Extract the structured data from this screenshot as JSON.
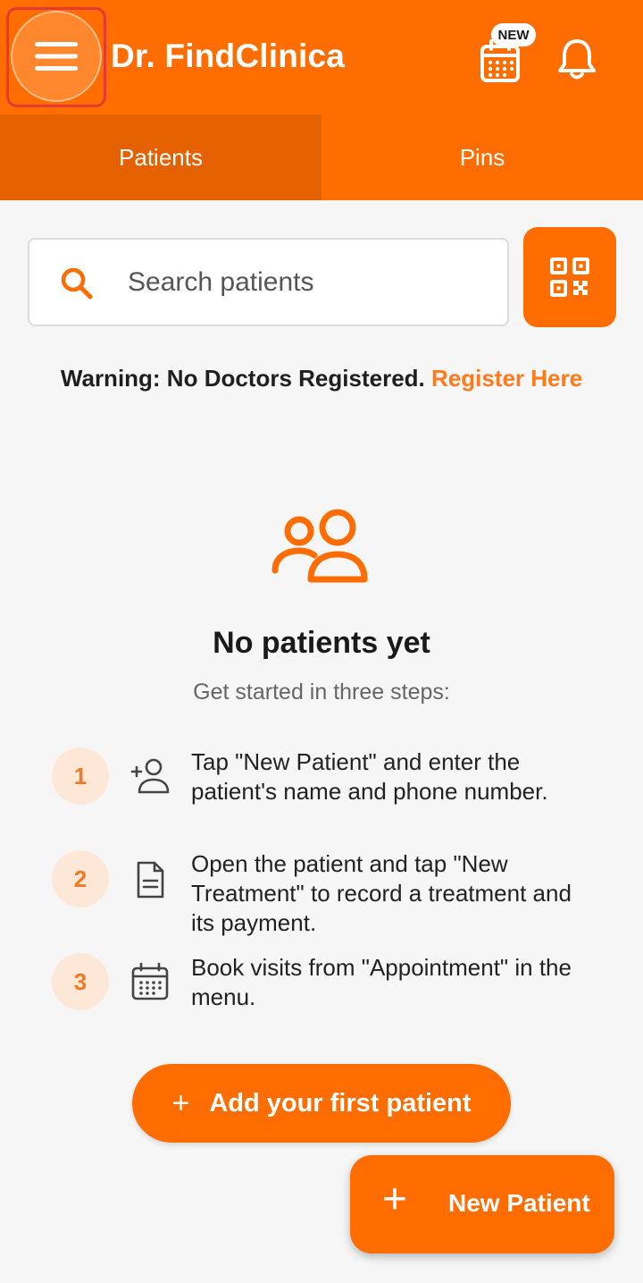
{
  "appbar": {
    "title": "Dr. FindClinica",
    "menu_icon": "hamburger-menu-icon",
    "calendar_icon": "calendar-icon",
    "new_badge": "NEW",
    "bell_icon": "bell-icon",
    "color": "#ff6d00"
  },
  "tabs": [
    {
      "label": "Patients",
      "active": true
    },
    {
      "label": "Pins",
      "active": false
    }
  ],
  "search": {
    "placeholder": "Search patients",
    "value": "",
    "icon": "search-icon",
    "qr_icon": "qr-code-icon"
  },
  "warning": {
    "text": "Warning: No Doctors Registered.",
    "link": "Register Here"
  },
  "empty_state": {
    "icon": "users-icon",
    "title": "No patients yet",
    "subtitle": "Get started in three steps:"
  },
  "steps": [
    {
      "number": "1",
      "icon": "add-user-icon",
      "text": "Tap \"New Patient\" and enter the patient's name and phone number."
    },
    {
      "number": "2",
      "icon": "document-icon",
      "text": "Open the patient and tap \"New Treatment\" to record a treatment and its payment."
    },
    {
      "number": "3",
      "icon": "calendar-icon",
      "text": "Book visits from \"Appointment\" in the menu."
    }
  ],
  "cta": {
    "label": "Add your first patient",
    "icon": "plus-icon"
  },
  "fab": {
    "label": "New Patient",
    "icon": "plus-icon"
  },
  "colors": {
    "accent": "#ff6d00",
    "accent_dark": "#e56100",
    "link": "#ff7a1a",
    "step_bg": "#fde8d8"
  }
}
